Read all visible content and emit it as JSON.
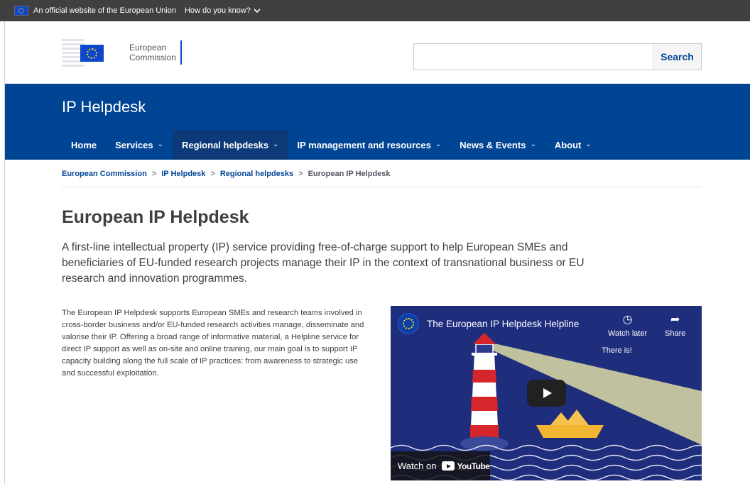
{
  "eu_bar": {
    "official_text": "An official website of the European Union",
    "how_know": "How do you know?",
    "chevron": "✓"
  },
  "header": {
    "logo_line1": "European",
    "logo_line2": "Commission",
    "search_placeholder": "",
    "search_button": "Search"
  },
  "site": {
    "title": "IP Helpdesk"
  },
  "nav": {
    "items": [
      {
        "label": "Home",
        "has_dropdown": false
      },
      {
        "label": "Services",
        "has_dropdown": true
      },
      {
        "label": "Regional helpdesks",
        "has_dropdown": true
      },
      {
        "label": "IP management and resources",
        "has_dropdown": true
      },
      {
        "label": "News & Events",
        "has_dropdown": true
      },
      {
        "label": "About",
        "has_dropdown": true
      }
    ],
    "chevron_glyph": "⌄"
  },
  "breadcrumb": {
    "items": [
      "European Commission",
      "IP Helpdesk",
      "Regional helpdesks"
    ],
    "current": "European IP Helpdesk",
    "separator": ">"
  },
  "main": {
    "title": "European IP Helpdesk",
    "lead": "A first-line intellectual property (IP) service providing free-of-charge support to help European SMEs and beneficiaries of EU-funded research projects manage their IP in the context of transnational business or EU research and innovation programmes.",
    "body": "The European IP Helpdesk supports European SMEs and research teams involved in cross-border business and/or EU-funded research activities manage, disseminate and valorise their IP. Offering a broad range of informative material, a Helpline service for direct IP support as well as on-site and online training, our main goal is to support IP capacity building along the full scale of IP practices: from awareness to strategic use and successful exploitation."
  },
  "video": {
    "title": "The European IP Helpdesk Helpline",
    "watch_later": "Watch later",
    "share": "Share",
    "overlay_text": "There is!",
    "watch_on": "Watch on",
    "youtube": "YouTube",
    "colors": {
      "background": "#1f2d7d",
      "beam": "#c9c9a0",
      "boat": "#f2b632",
      "stripe_red": "#d6262b"
    }
  },
  "colors": {
    "eu_blue": "#004494",
    "nav_active": "#0c3a78",
    "top_bar": "#404040"
  }
}
